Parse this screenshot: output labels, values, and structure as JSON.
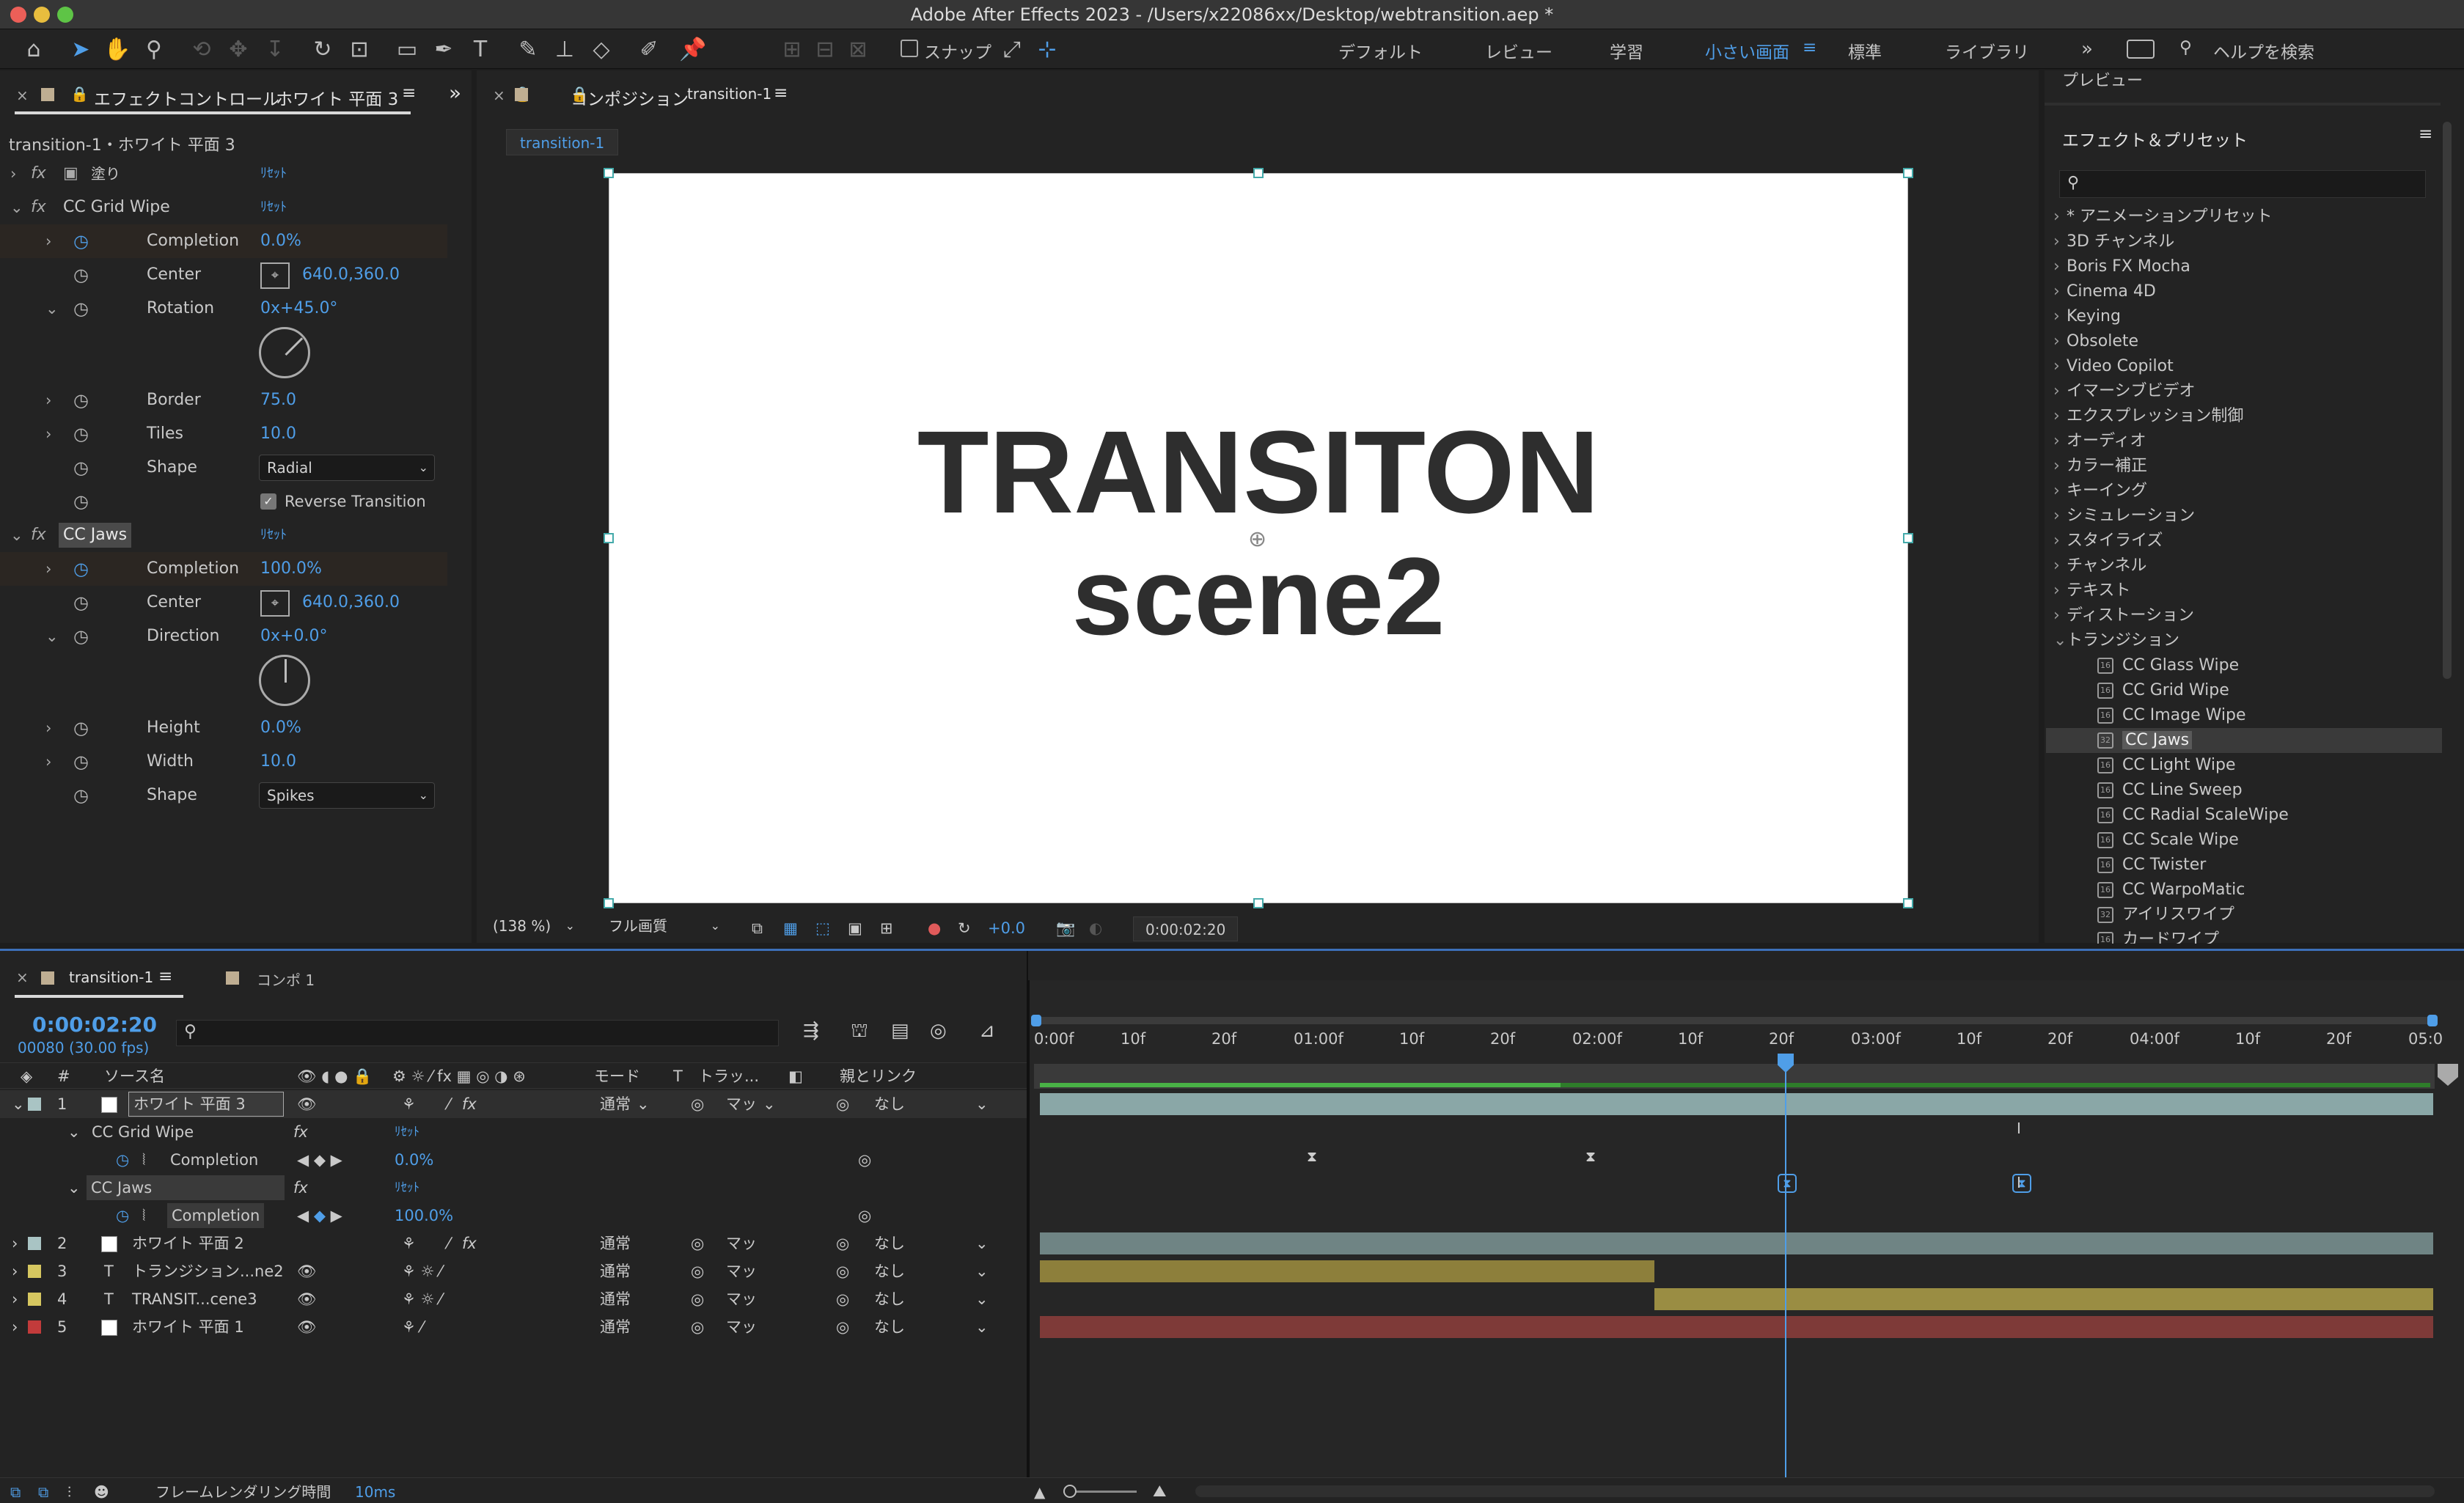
{
  "window": {
    "title": "Adobe After Effects 2023 - /Users/x22086xx/Desktop/webtransition.aep *"
  },
  "toolbar": {
    "snap_label": "スナップ",
    "workspaces": [
      "デフォルト",
      "レビュー",
      "学習",
      "小さい画面",
      "標準",
      "ライブラリ"
    ],
    "active_workspace": "小さい画面",
    "help_placeholder": "ヘルプを検索"
  },
  "effect_controls": {
    "tab_label": "エフェクトコントロール",
    "tab_layer": "ホワイト 平面 3",
    "breadcrumb": "transition-1・ホワイト 平面 3",
    "reset": "ﾘｾｯﾄ",
    "fill": {
      "name": "塗り"
    },
    "grid_wipe": {
      "name": "CC Grid Wipe",
      "completion": "0.0%",
      "center": "640.0,360.0",
      "rotation": "0x+45.0°",
      "border": "75.0",
      "tiles": "10.0",
      "shape": "Radial",
      "reverse": "Reverse Transition"
    },
    "jaws": {
      "name": "CC Jaws",
      "completion": "100.0%",
      "center": "640.0,360.0",
      "direction": "0x+0.0°",
      "height": "0.0%",
      "width": "10.0",
      "shape": "Spikes"
    },
    "labels": {
      "completion": "Completion",
      "center": "Center",
      "rotation": "Rotation",
      "border": "Border",
      "tiles": "Tiles",
      "shape": "Shape",
      "direction": "Direction",
      "height": "Height",
      "width": "Width"
    }
  },
  "composition": {
    "tab_label": "コンポジション",
    "comp_name": "transition-1",
    "subtab": "transition-1",
    "text_line1": "TRANSITON",
    "text_line2": "scene2",
    "zoom": "(138 %)",
    "quality": "フル画質",
    "exposure": "+0.0",
    "timecode": "0:00:02:20"
  },
  "right_panel": {
    "preview_label": "プレビュー",
    "title": "エフェクト＆プリセット",
    "categories": [
      "* アニメーションプリセット",
      "3D チャンネル",
      "Boris FX Mocha",
      "Cinema 4D",
      "Keying",
      "Obsolete",
      "Video Copilot",
      "イマーシブビデオ",
      "エクスプレッション制御",
      "オーディオ",
      "カラー補正",
      "キーイング",
      "シミュレーション",
      "スタイライズ",
      "チャンネル",
      "テキスト",
      "ディストーション",
      "トランジション"
    ],
    "transitions": [
      "CC Glass Wipe",
      "CC Grid Wipe",
      "CC Image Wipe",
      "CC Jaws",
      "CC Light Wipe",
      "CC Line Sweep",
      "CC Radial ScaleWipe",
      "CC Scale Wipe",
      "CC Twister",
      "CC WarpoMatic",
      "アイリスワイプ",
      "カードワイプ"
    ],
    "selected_transition": "CC Jaws"
  },
  "timeline": {
    "tab_label": "transition-1",
    "tab2_label": "コンポ 1",
    "timecode": "0:00:02:20",
    "frames": "00080 (30.00 fps)",
    "col_source": "ソース名",
    "col_mode": "モード",
    "col_t": "T",
    "col_track": "トラッ...",
    "col_parent": "親とリンク",
    "layers": [
      {
        "num": "1",
        "name": "ホワイト 平面 3",
        "mode": "通常",
        "track": "マッ",
        "parent": "なし",
        "color": "#a9c4c4"
      },
      {
        "num": "2",
        "name": "ホワイト 平面 2",
        "mode": "通常",
        "track": "マッ",
        "parent": "なし",
        "color": "#a9c4c4"
      },
      {
        "num": "3",
        "name": "トランジション...ne2",
        "mode": "通常",
        "track": "マッ",
        "parent": "なし",
        "color": "#d6c760"
      },
      {
        "num": "4",
        "name": "TRANSIT...cene3",
        "mode": "通常",
        "track": "マッ",
        "parent": "なし",
        "color": "#d6c760"
      },
      {
        "num": "5",
        "name": "ホワイト 平面 1",
        "mode": "通常",
        "track": "マッ",
        "parent": "なし",
        "color": "#c23b3b"
      }
    ],
    "sub": {
      "grid_wipe": "CC Grid Wipe",
      "jaws": "CC Jaws",
      "completion": "Completion",
      "gw_val": "0.0%",
      "jaws_val": "100.0%",
      "reset": "ﾘｾｯﾄ"
    },
    "ruler": [
      "0:00f",
      "10f",
      "20f",
      "01:00f",
      "10f",
      "20f",
      "02:00f",
      "10f",
      "20f",
      "03:00f",
      "10f",
      "20f",
      "04:00f",
      "10f",
      "20f",
      "05:0"
    ],
    "status_label": "フレームレンダリング時間",
    "status_val": "10ms"
  }
}
